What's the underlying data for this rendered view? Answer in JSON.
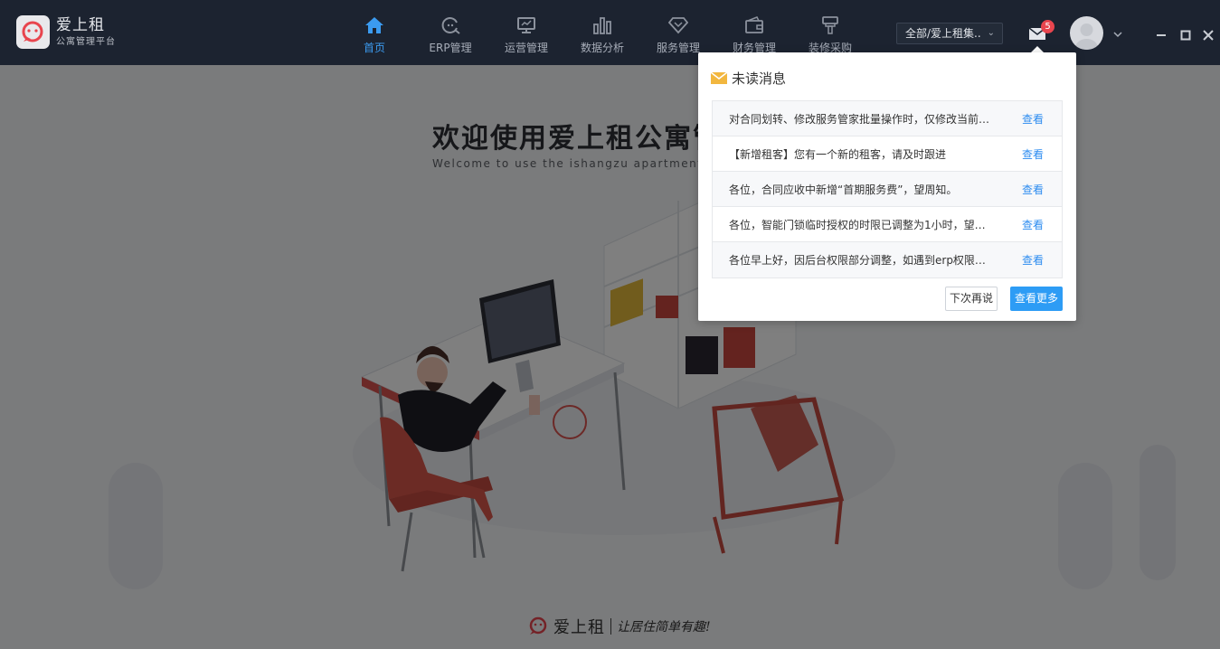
{
  "brand": {
    "name": "爱上租",
    "subtitle": "公寓管理平台",
    "accent": "#e8454e"
  },
  "nav": {
    "items": [
      {
        "label": "首页",
        "icon": "home-icon",
        "active": true
      },
      {
        "label": "ERP管理",
        "icon": "erp-icon",
        "active": false
      },
      {
        "label": "运营管理",
        "icon": "monitor-icon",
        "active": false
      },
      {
        "label": "数据分析",
        "icon": "bar-chart-icon",
        "active": false
      },
      {
        "label": "服务管理",
        "icon": "diamond-icon",
        "active": false
      },
      {
        "label": "财务管理",
        "icon": "wallet-icon",
        "active": false
      },
      {
        "label": "装修采购",
        "icon": "paint-roller-icon",
        "active": false
      }
    ],
    "active_color": "#3b9bf0"
  },
  "header": {
    "store_select": "全部/爱上租集..",
    "unread_count": "5"
  },
  "main": {
    "welcome_title": "欢迎使用爱上租公寓管",
    "welcome_sub": "Welcome to use the ishangzu apartment man",
    "footer_brand": "爱上租",
    "footer_slogan": "让居住简单有趣!"
  },
  "popup": {
    "title": "未读消息",
    "messages": [
      {
        "text": "对合同划转、修改服务管家批量操作时，仅修改当前…",
        "link": "查看"
      },
      {
        "text": "【新增租客】您有一个新的租客，请及时跟进",
        "link": "查看"
      },
      {
        "text": "各位，合同应收中新增“首期服务费”，望周知。",
        "link": "查看"
      },
      {
        "text": "各位，智能门锁临时授权的时限已调整为1小时，望…",
        "link": "查看"
      },
      {
        "text": "各位早上好，因后台权限部分调整，如遇到erp权限…",
        "link": "查看"
      }
    ],
    "later_button": "下次再说",
    "more_button": "查看更多"
  }
}
